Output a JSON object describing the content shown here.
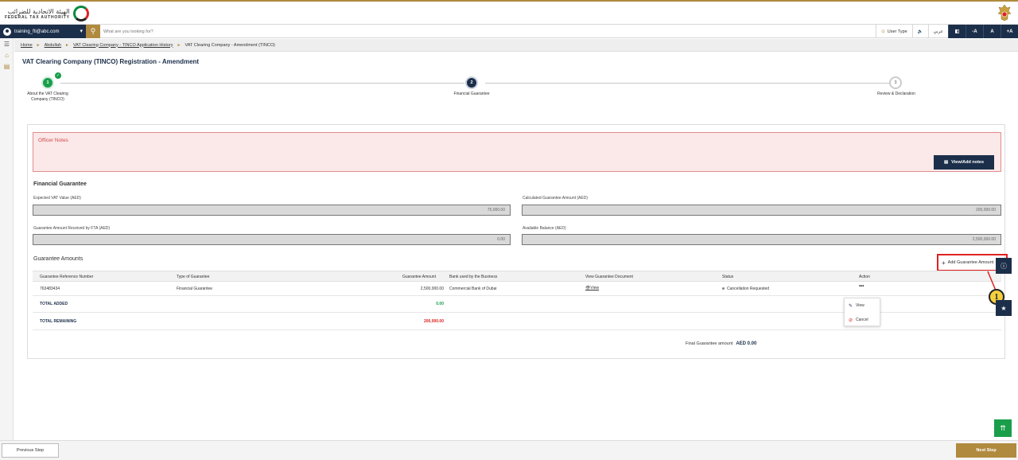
{
  "header": {
    "logo_ar": "الهيئة الاتحادية للضرائب",
    "logo_en": "FEDERAL TAX AUTHORITY"
  },
  "searchbar": {
    "user": "training_fti@abc.com",
    "placeholder": "What are you looking for?",
    "user_type": "User Type",
    "lang": "عربي",
    "font_small": "-A",
    "font_normal": "A",
    "font_large": "+A"
  },
  "breadcrumb": {
    "items": [
      "Home",
      "Abdullah",
      "VAT Clearing Company - TINCO Application History",
      "VAT Clearing Company - Amendment (TINCO)"
    ]
  },
  "page": {
    "title": "VAT Clearing Company (TINCO) Registration - Amendment"
  },
  "stepper": {
    "steps": [
      {
        "num": "1",
        "label": "About the VAT Clearing Company (TINCO)"
      },
      {
        "num": "2",
        "label": "Financial Guarantee"
      },
      {
        "num": "3",
        "label": "Review & Declaration"
      }
    ]
  },
  "notes": {
    "title": "Officer Notes",
    "button": "View/Add notes"
  },
  "financial": {
    "title": "Financial Guarantee",
    "expected_label": "Expected VAT Value (AED)",
    "expected_value": "75,000.00",
    "calculated_label": "Calculated Guarantee Amount (AED)",
    "calculated_value": "200,000.00",
    "received_label": "Guarantee Amount Received by FTA (AED)",
    "received_value": "0.00",
    "balance_label": "Available Balance (AED)",
    "balance_value": "2,500,000.00"
  },
  "amounts": {
    "title": "Guarantee Amounts",
    "add_button": "Add Guarantee Amount",
    "columns": [
      "Guarantee Reference Number",
      "Type of Guarantee",
      "Guarantee Amount",
      "Bank used by the Business",
      "View Guarantee Document",
      "Status",
      "Action"
    ],
    "row": {
      "ref": "763483434",
      "type": "Financial Guarantee",
      "amount": "2,500,000.00",
      "bank": "Commercial Bank of Dubai",
      "view": "View",
      "status": "Cancellation Requested",
      "action": "•••"
    },
    "total_added_label": "TOTAL ADDED",
    "total_added_value": "0.00",
    "total_remaining_label": "TOTAL REMAINING",
    "total_remaining_value": "200,000.00",
    "menu_view": "View",
    "menu_cancel": "Cancel",
    "final_label": "Final Guarantee amount",
    "final_value": "AED  0.00"
  },
  "callout": "1",
  "footer": {
    "prev": "Previous Step",
    "next": "Next Step"
  },
  "colors": {
    "navy": "#1c2f4a",
    "gold": "#b08a3e",
    "green": "#1a9e4a",
    "red": "#d22222"
  }
}
